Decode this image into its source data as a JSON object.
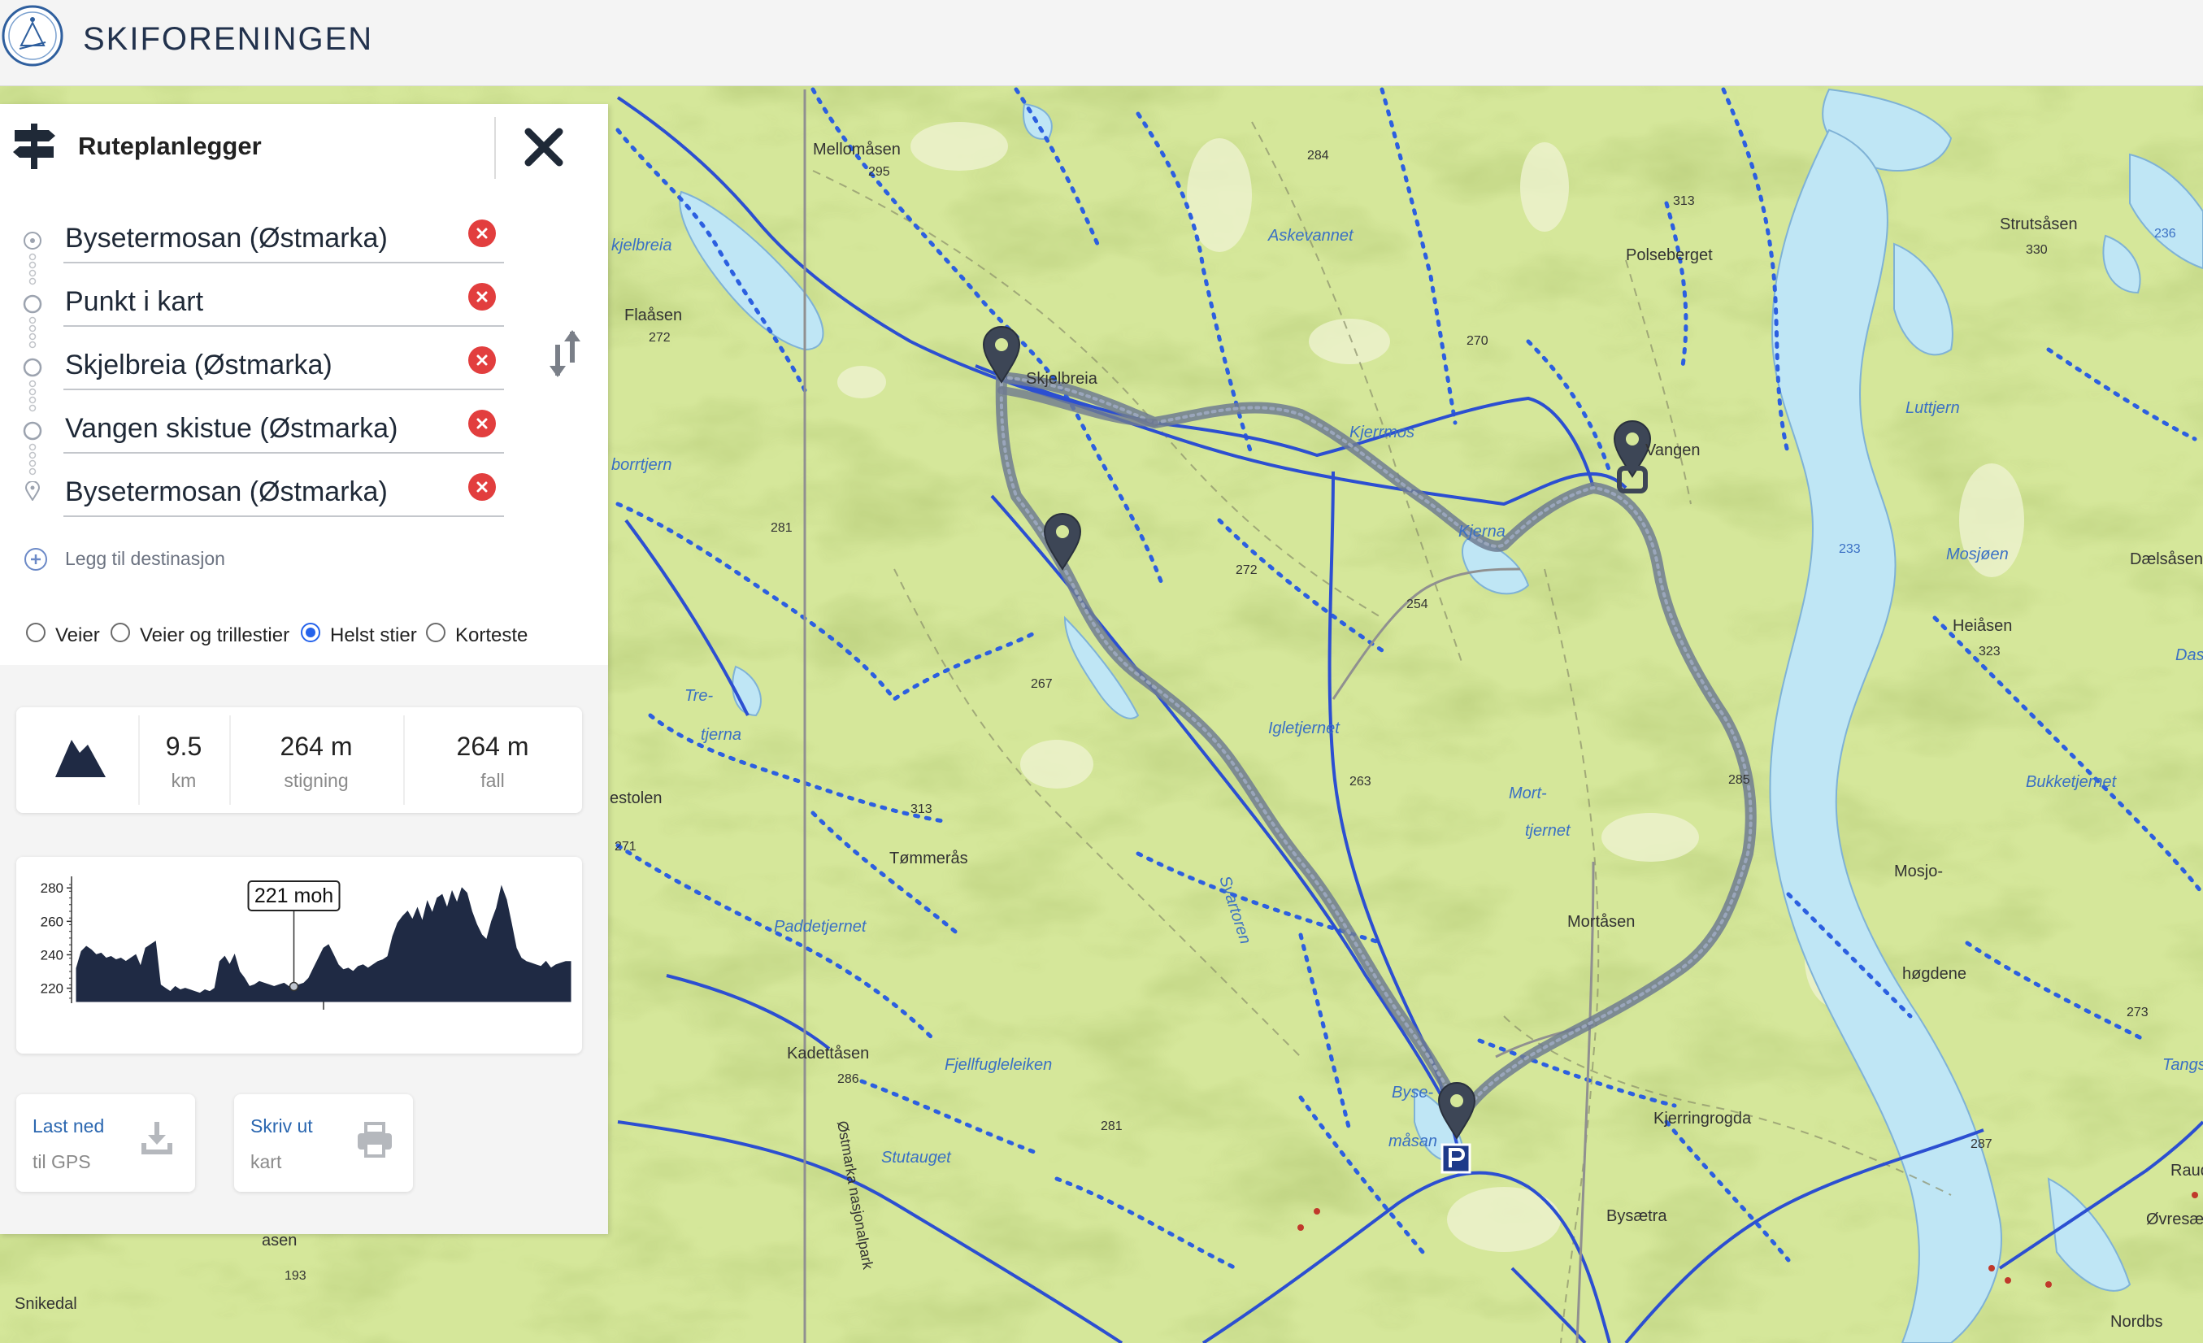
{
  "header": {
    "brand": "SKIFORENINGEN"
  },
  "panel": {
    "title": "Ruteplanlegger",
    "waypoints": [
      {
        "label": "Bysetermosan (Østmarka)"
      },
      {
        "label": "Punkt i kart"
      },
      {
        "label": "Skjelbreia (Østmarka)"
      },
      {
        "label": "Vangen skistue (Østmarka)"
      },
      {
        "label": "Bysetermosan (Østmarka)"
      }
    ],
    "add_destination": "Legg til destinasjon",
    "route_options": [
      {
        "label": "Veier",
        "checked": false
      },
      {
        "label": "Veier og trillestier",
        "checked": false
      },
      {
        "label": "Helst stier",
        "checked": true
      },
      {
        "label": "Korteste",
        "checked": false
      }
    ]
  },
  "stats": {
    "distance_value": "9.5",
    "distance_unit": "km",
    "ascent_value": "264 m",
    "ascent_label": "stigning",
    "descent_value": "264 m",
    "descent_label": "fall"
  },
  "chart_data": {
    "type": "area",
    "title": "",
    "xlabel": "",
    "ylabel": "",
    "y_ticks": [
      "280",
      "260",
      "240",
      "220"
    ],
    "ylim": [
      212,
      284
    ],
    "tooltip": "221 moh",
    "cursor_index": 44,
    "x": [
      0,
      1,
      2,
      3,
      4,
      5,
      6,
      7,
      8,
      9,
      10,
      11,
      12,
      13,
      14,
      15,
      16,
      17,
      18,
      19,
      20,
      21,
      22,
      23,
      24,
      25,
      26,
      27,
      28,
      29,
      30,
      31,
      32,
      33,
      34,
      35,
      36,
      37,
      38,
      39,
      40,
      41,
      42,
      43,
      44,
      45,
      46,
      47,
      48,
      49,
      50,
      51,
      52,
      53,
      54,
      55,
      56,
      57,
      58,
      59,
      60,
      61,
      62,
      63,
      64,
      65,
      66,
      67,
      68,
      69,
      70,
      71,
      72,
      73,
      74,
      75,
      76,
      77,
      78,
      79,
      80,
      81,
      82,
      83,
      84,
      85,
      86,
      87,
      88,
      89,
      90,
      91,
      92,
      93,
      94,
      95,
      96,
      97,
      98,
      99,
      100
    ],
    "values": [
      232,
      242,
      245,
      243,
      240,
      241,
      238,
      239,
      237,
      238,
      236,
      238,
      240,
      233,
      244,
      246,
      248,
      222,
      220,
      218,
      221,
      219,
      220,
      219,
      218,
      217,
      219,
      218,
      220,
      236,
      239,
      234,
      240,
      230,
      226,
      221,
      222,
      224,
      223,
      222,
      221,
      222,
      223,
      221,
      221,
      222,
      223,
      226,
      232,
      238,
      244,
      246,
      240,
      234,
      231,
      232,
      230,
      233,
      234,
      232,
      234,
      236,
      237,
      239,
      251,
      259,
      263,
      266,
      261,
      268,
      260,
      272,
      265,
      274,
      276,
      268,
      278,
      271,
      280,
      277,
      266,
      258,
      252,
      249,
      260,
      268,
      281,
      273,
      259,
      244,
      238,
      236,
      235,
      234,
      233,
      236,
      232,
      234,
      235,
      236,
      236
    ],
    "series": [
      {
        "values": []
      }
    ]
  },
  "actions": {
    "download_t1": "Last ned",
    "download_t2": "til GPS",
    "print_t1": "Skriv ut",
    "print_t2": "kart"
  },
  "map": {
    "water_color": "#bfe6f5",
    "land_color": "#d5e79a",
    "route_color": "#6f7b90",
    "place_labels": [
      "Mellomåsen",
      "295",
      "Askevannet",
      "284",
      "313",
      "Polseberget",
      "Strutsåsen",
      "330",
      "236",
      "Skjelbreia",
      "Flaåsen",
      "272",
      "270",
      "Kjerrmos",
      "Vangen",
      "Luttjern",
      "Kjerna",
      "Mosjøen",
      "233",
      "Dælsåsen",
      "254",
      "272",
      "281",
      "267",
      "Heiåsen",
      "323",
      "Igletjernet",
      "263",
      "285",
      "Mort-",
      "tjernet",
      "Bukketjernet",
      "estolen",
      "313",
      "Tømmerås",
      "271",
      "Svartoren",
      "Mosjo-",
      "høgdene",
      "Paddetjernet",
      "Mortåsen",
      "273",
      "Kadettåsen",
      "286",
      "Fjellfugleleiken",
      "281",
      "Kjerringrogda",
      "287",
      "Stutauget",
      "Byse-",
      "måsan",
      "Bysætra",
      "Snikedal",
      "193",
      "Nordbs",
      "Øvresæ",
      "Raud",
      "Tangs",
      "Das",
      "Tre-",
      "tjerna",
      "borrtjern",
      "kjelbreia",
      "Østmarka nasjonalpark",
      "asen"
    ]
  }
}
